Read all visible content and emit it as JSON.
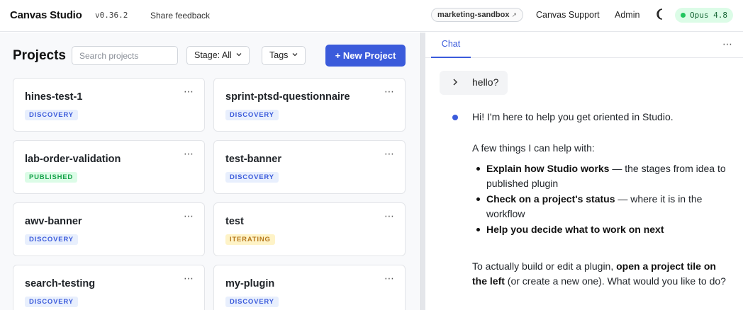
{
  "header": {
    "brand": "Canvas Studio",
    "version": "v0.36.2",
    "feedback": "Share feedback",
    "environment": "marketing-sandbox",
    "environment_icon": "↗",
    "support": "Canvas Support",
    "admin": "Admin",
    "theme_icon": "moon-icon",
    "model": "Opus 4.8",
    "model_status_color": "#22c55e"
  },
  "projects": {
    "title": "Projects",
    "search_placeholder": "Search projects",
    "stage_filter": "Stage: All",
    "tags_filter": "Tags",
    "new_button": "+ New Project",
    "accent_color": "#3b5bdb",
    "cards": [
      {
        "name": "hines-test-1",
        "stage": "DISCOVERY"
      },
      {
        "name": "sprint-ptsd-questionnaire",
        "stage": "DISCOVERY"
      },
      {
        "name": "lab-order-validation",
        "stage": "PUBLISHED"
      },
      {
        "name": "test-banner",
        "stage": "DISCOVERY"
      },
      {
        "name": "awv-banner",
        "stage": "DISCOVERY"
      },
      {
        "name": "test",
        "stage": "ITERATING"
      },
      {
        "name": "search-testing",
        "stage": "DISCOVERY"
      },
      {
        "name": "my-plugin",
        "stage": "DISCOVERY"
      }
    ],
    "more_icon": "⋯"
  },
  "chat": {
    "tab": "Chat",
    "more_icon": "⋯",
    "user_message": "hello?",
    "greeting": "Hi! I'm here to help you get oriented in Studio.",
    "intro": "A few things I can help with:",
    "bullets": [
      {
        "bold": "Explain how Studio works",
        "rest": " — the stages from idea to published plugin"
      },
      {
        "bold": "Check on a project's status",
        "rest": " — where it is in the workflow"
      },
      {
        "bold": "Help you decide what to work on next",
        "rest": ""
      }
    ],
    "closing_pre": "To actually build or edit a plugin, ",
    "closing_bold": "open a project tile on the left",
    "closing_post": " (or create a new one). What would you like to do?"
  }
}
